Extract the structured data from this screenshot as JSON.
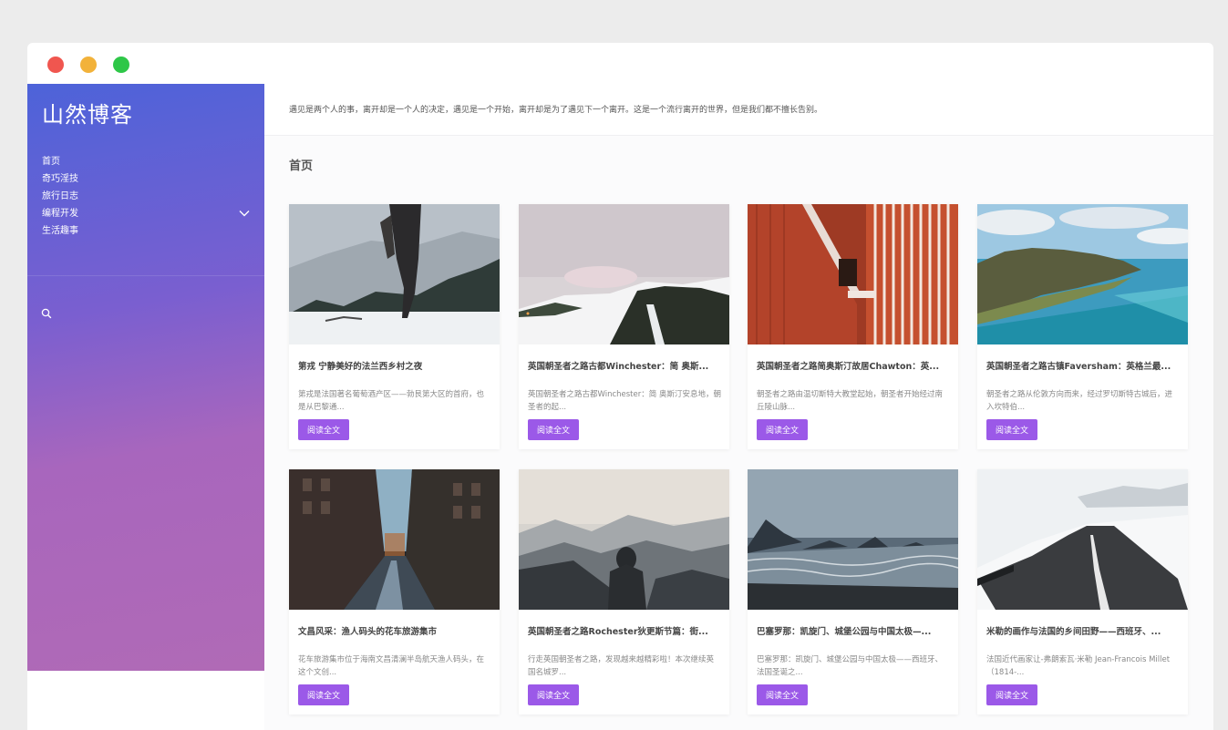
{
  "window": {
    "controls": [
      "close",
      "minimize",
      "maximize"
    ],
    "colors": {
      "close": "#f0564f",
      "minimize": "#f2b23a",
      "maximize": "#2ec748"
    }
  },
  "sidebar": {
    "title": "山然博客",
    "nav": [
      {
        "label": "首页"
      },
      {
        "label": "奇巧淫技"
      },
      {
        "label": "旅行日志"
      },
      {
        "label": "编程开发",
        "has_submenu": true
      },
      {
        "label": "生活趣事"
      }
    ],
    "search_icon": "search-icon"
  },
  "main": {
    "quote": "遇见是两个人的事，离开却是一个人的决定，遇见是一个开始，离开却是为了遇见下一个离开。这是一个流行离开的世界，但是我们都不擅长告别。",
    "section_title": "首页",
    "read_more_label": "阅读全文",
    "posts": [
      {
        "title": "第戎 宁静美好的法兰西乡村之夜",
        "excerpt": "第戎是法国著名葡萄酒产区——勃艮第大区的首府，也是从巴黎通..."
      },
      {
        "title": "英国朝圣者之路古都Winchester：简 奥斯...",
        "excerpt": "英国朝圣者之路古都Winchester：简 奥斯汀安息地，朝圣者的起..."
      },
      {
        "title": "英国朝圣者之路简奥斯汀故居Chawton：英...",
        "excerpt": "朝圣者之路由温切斯特大教堂起始，朝圣者开始经过南丘陵山脉..."
      },
      {
        "title": "英国朝圣者之路古镇Faversham：英格兰最...",
        "excerpt": "朝圣者之路从伦敦方向而来，经过罗切斯特古城后，进入坎特伯..."
      },
      {
        "title": "文昌风采：渔人码头的花车旅游集市",
        "excerpt": "花车旅游集市位于海南文昌清澜半岛航天渔人码头，在这个文创..."
      },
      {
        "title": "英国朝圣者之路Rochester狄更斯节篇：街...",
        "excerpt": "行走英国朝圣者之路，发现越来越精彩啦！本次继续英国名城罗..."
      },
      {
        "title": "巴塞罗那：凯旋门、城堡公园与中国太极—...",
        "excerpt": "巴塞罗那：凯旋门、城堡公园与中国太极——西班牙、法国圣诞之..."
      },
      {
        "title": "米勒的画作与法国的乡间田野——西班牙、...",
        "excerpt": "法国近代画家让-弗朗索瓦·米勒 Jean-Francois Millet（1814-..."
      }
    ]
  },
  "colors": {
    "accent_button": "#9b59e8",
    "sidebar_gradient_top": "#4d63d9",
    "sidebar_gradient_bottom": "#b06ab6"
  }
}
